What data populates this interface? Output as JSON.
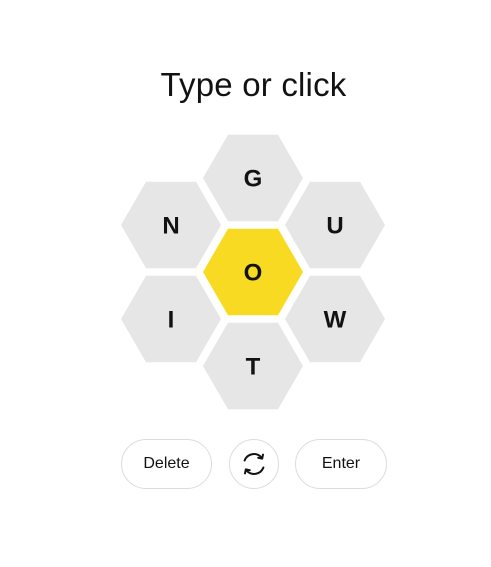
{
  "prompt": "Type or click",
  "colors": {
    "center": "#f7da21",
    "outer": "#e6e6e6",
    "text": "#121212"
  },
  "hive": {
    "center_letter": "O",
    "outer_letters": [
      "G",
      "U",
      "W",
      "T",
      "I",
      "N"
    ]
  },
  "buttons": {
    "delete_label": "Delete",
    "shuffle_icon": "shuffle-icon",
    "enter_label": "Enter"
  }
}
